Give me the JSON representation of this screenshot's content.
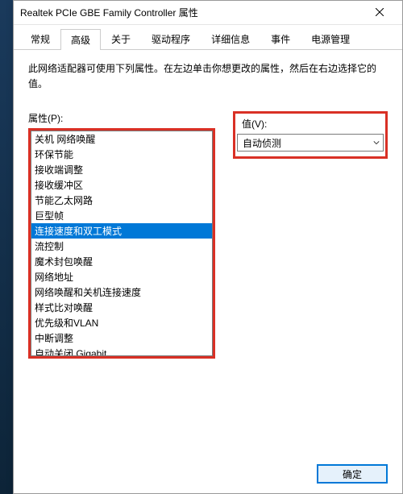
{
  "window": {
    "title": "Realtek PCIe GBE Family Controller 属性"
  },
  "tabs": {
    "items": [
      "常规",
      "高级",
      "关于",
      "驱动程序",
      "详细信息",
      "事件",
      "电源管理"
    ],
    "active_index": 1
  },
  "instruction": "此网络适配器可使用下列属性。在左边单击你想更改的属性，然后在右边选择它的值。",
  "property": {
    "label": "属性(P):",
    "items": [
      "关机 网络唤醒",
      "环保节能",
      "接收端调整",
      "接收缓冲区",
      "节能乙太网路",
      "巨型帧",
      "连接速度和双工模式",
      "流控制",
      "魔术封包唤醒",
      "网络地址",
      "网络唤醒和关机连接速度",
      "样式比对唤醒",
      "优先级和VLAN",
      "中断调整",
      "自动关闭 Gigabit"
    ],
    "selected_index": 6
  },
  "value": {
    "label": "值(V):",
    "selected": "自动侦测"
  },
  "buttons": {
    "ok": "确定"
  },
  "highlight_color": "#d93025"
}
